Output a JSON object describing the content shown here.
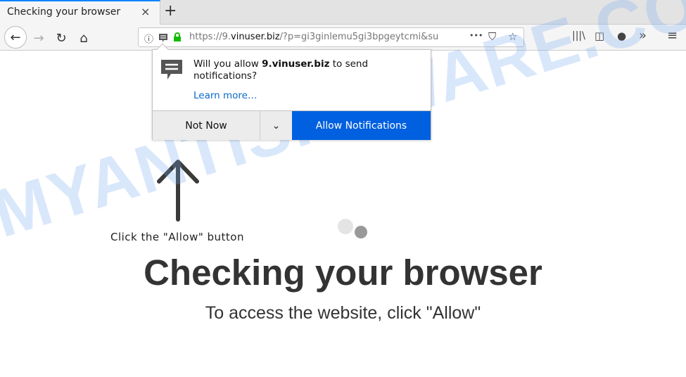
{
  "tab": {
    "title": "Checking your browser",
    "close": "×",
    "new_tab": "+"
  },
  "nav": {
    "url_prefix": "https://9.",
    "url_domain": "vinuser.biz",
    "url_rest": "/?p=gi3ginlemu5gi3bpgeytcmi&su",
    "more": "•••"
  },
  "popup": {
    "msg_pre": "Will you allow ",
    "msg_domain": "9.vinuser.biz",
    "msg_post": " to send notifications?",
    "learn_more": "Learn more…",
    "not_now": "Not Now",
    "allow": "Allow Notifications"
  },
  "page": {
    "hint": "Click the \"Allow\" button",
    "heading": "Checking your browser",
    "subheading": "To access the website, click \"Allow\""
  },
  "watermark": "MYANTISPYWARE.COM",
  "colors": {
    "accent": "#0060df",
    "link": "#0a6ac8",
    "secure": "#12bc00"
  }
}
